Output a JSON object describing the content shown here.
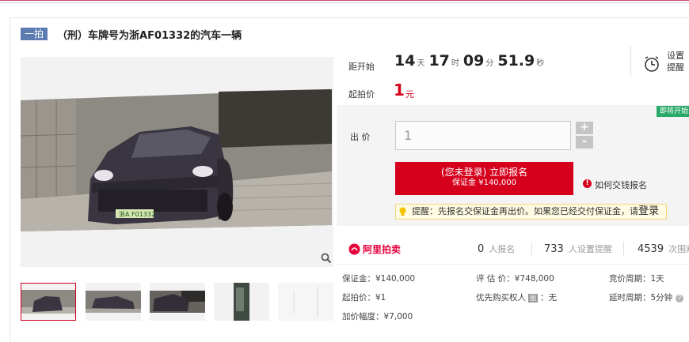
{
  "header": {
    "badge": "一拍",
    "title": "（刑）车牌号为浙AF01332的汽车一辆"
  },
  "gallery": {
    "plate_text": "浙A F01332",
    "thumbnails": [
      "thumb-1",
      "thumb-2",
      "thumb-3",
      "thumb-4",
      "thumb-5"
    ]
  },
  "auction": {
    "countdown_label": "距开始",
    "countdown": {
      "days": "14",
      "days_unit": "天",
      "hours": "17",
      "hours_unit": "时",
      "minutes": "09",
      "minutes_unit": "分",
      "seconds": "51.9",
      "seconds_unit": "秒"
    },
    "reminder": "设置 提醒",
    "start_price_label": "起拍价",
    "start_price": "1",
    "start_price_unit": "元",
    "tag": "即将开始",
    "bid_label": "出 价",
    "bid_value": "1",
    "plus": "+",
    "minus": "-",
    "register_button": "(您未登录) 立即报名",
    "register_deposit": "保证金 ¥140,000",
    "how_to_pay": "如何交钱报名",
    "tip_text": "提醒：先报名交保证金再出价。如果您已经交付保证金，请",
    "tip_link": "登录"
  },
  "stats": {
    "brand": "阿里拍卖",
    "registered_count": "0",
    "registered_label": "人报名",
    "reminders_count": "733",
    "reminders_label": "人设置提醒",
    "views_count": "4539",
    "views_label": "次围观"
  },
  "details": {
    "deposit": "保证金：¥140,000",
    "appraisal": "评 估 价：¥748,000",
    "bid_period": "竞价周期：1天",
    "start_price": "起拍价：¥1",
    "priority_buyer_label": "优先购买权人",
    "priority_buyer_badge": "图",
    "priority_buyer_value": "：无",
    "delay_period": "延时周期：5分钟",
    "increment": "加价幅度：¥7,000"
  },
  "colors": {
    "accent_red": "#d6001c",
    "badge_blue": "#5c7bb0",
    "tag_green": "#28a86a"
  }
}
